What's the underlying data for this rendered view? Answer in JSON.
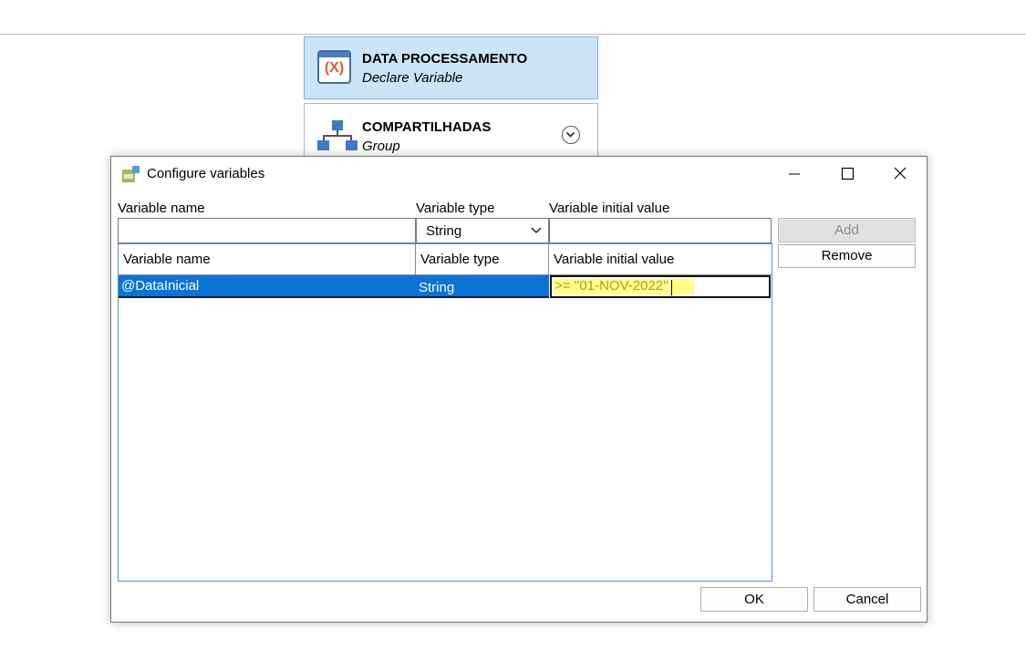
{
  "workflow": {
    "declare_node": {
      "title": "DATA PROCESSAMENTO",
      "subtitle": "Declare Variable",
      "icon": "declare-variable-icon",
      "icon_text": "(X)"
    },
    "group_node": {
      "title": "COMPARTILHADAS",
      "subtitle": "Group",
      "icon": "group-hierarchy-icon"
    }
  },
  "dialog": {
    "title": "Configure variables",
    "window_buttons": {
      "minimize": "minimize-icon",
      "maximize": "maximize-icon",
      "close": "close-icon"
    },
    "labels": {
      "variable_name": "Variable name",
      "variable_type": "Variable type",
      "variable_initial_value": "Variable initial value"
    },
    "inputs": {
      "variable_name": "",
      "variable_type_selected": "String",
      "variable_initial_value": ""
    },
    "buttons": {
      "add": "Add",
      "remove": "Remove",
      "ok": "OK",
      "cancel": "Cancel"
    },
    "grid": {
      "headers": [
        "Variable name",
        "Variable type",
        "Variable initial value"
      ],
      "rows": [
        {
          "name": "@DataInicial",
          "type": "String",
          "initial_value": ">= ''01-NOV-2022''"
        }
      ]
    }
  },
  "colors": {
    "selection": "#0a74d6",
    "declare_node_bg": "#cce4f7",
    "highlight": "#fdff86"
  }
}
